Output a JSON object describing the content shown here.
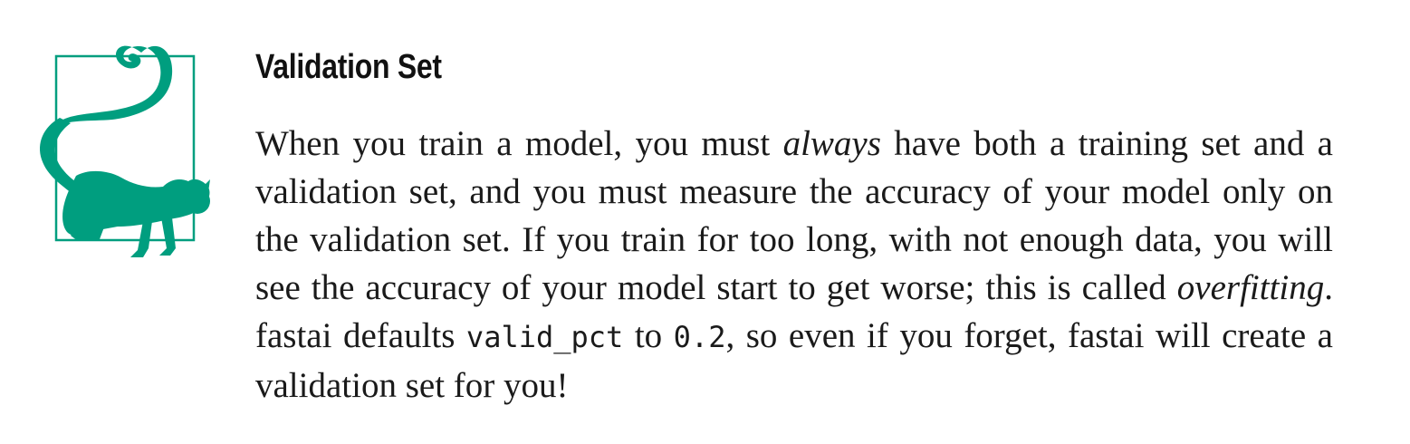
{
  "note": {
    "title": "Validation Set",
    "icon": "lemur-icon",
    "accent_color": "#009e7f",
    "body": {
      "part1": "When you train a model, you must ",
      "em1": "always",
      "part2": " have both a training set and a validation set, and you must measure the accuracy of your model only on the validation set. If you train for too long, with not enough data, you will see the accuracy of your model start to get worse; this is called ",
      "em2": "overfitting",
      "part3": ". fastai defaults ",
      "code1": "valid_pct",
      "part4": " to ",
      "code2": "0.2",
      "part5": ", so even if you forget, fastai will create a validation set for you!"
    }
  }
}
